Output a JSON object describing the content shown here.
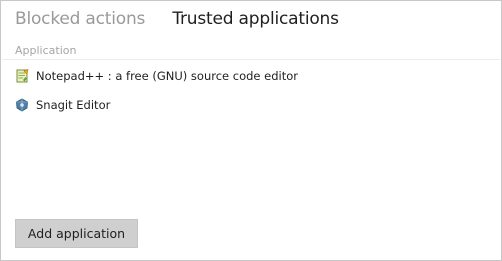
{
  "tabs": [
    {
      "label": "Blocked actions",
      "active": false
    },
    {
      "label": "Trusted applications",
      "active": true
    }
  ],
  "table": {
    "column_header": "Application",
    "rows": [
      {
        "name": "Notepad++ : a free (GNU) source code editor",
        "icon": "notepad-plus-plus-icon"
      },
      {
        "name": "Snagit Editor",
        "icon": "snagit-editor-icon"
      }
    ]
  },
  "actions": {
    "add_label": "Add application"
  },
  "colors": {
    "inactive_tab": "#9a9a9a",
    "active_tab": "#1f1f1f",
    "header_text": "#a5a5a5",
    "button_bg": "#cfcfcf"
  }
}
